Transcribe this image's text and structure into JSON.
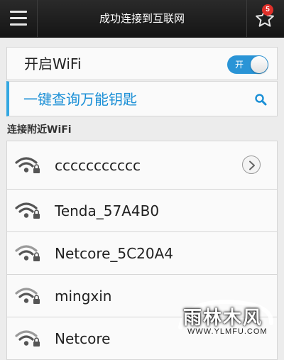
{
  "header": {
    "title": "成功连接到互联网",
    "menu_icon": "hamburger-menu-icon",
    "favorites_icon": "star-icon",
    "favorites_badge": "5"
  },
  "wifi_switch": {
    "label": "开启WiFi",
    "toggle_text": "开",
    "state": "on"
  },
  "key_search": {
    "label": "一键查询万能钥匙",
    "icon": "search-icon"
  },
  "nearby": {
    "section_title": "连接附近WiFi",
    "networks": [
      {
        "ssid": "ccccccccccc",
        "locked": true,
        "has_detail_button": true
      },
      {
        "ssid": "Tenda_57A4B0",
        "locked": true
      },
      {
        "ssid": "Netcore_5C20A4",
        "locked": true
      },
      {
        "ssid": "mingxin",
        "locked": true
      },
      {
        "ssid": "Netcore",
        "locked": true
      }
    ]
  },
  "watermark": {
    "text": "雨林木风",
    "url": "WWW.YLMFU.COM"
  },
  "colors": {
    "accent": "#2a94d6",
    "search_text": "#1a8fd6",
    "badge": "#e0302a",
    "topbar": "#1e1e1e"
  }
}
